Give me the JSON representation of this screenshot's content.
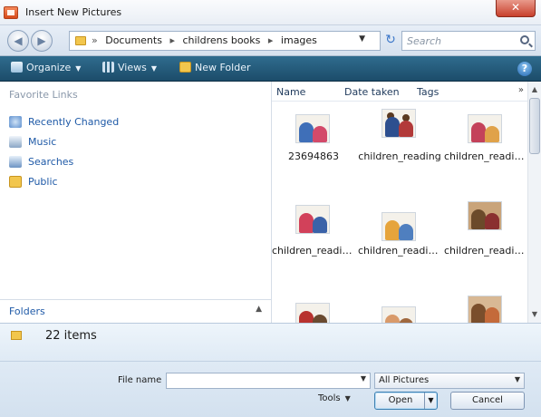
{
  "window": {
    "title": "Insert New Pictures",
    "close_glyph": "✕"
  },
  "address": {
    "crumbs": [
      "Documents",
      "childrens books",
      "images"
    ],
    "separator": "▸",
    "prefix": "»",
    "search_placeholder": "Search"
  },
  "toolbar": {
    "organize": "Organize",
    "views": "Views",
    "new_folder": "New Folder",
    "help_glyph": "?"
  },
  "nav": {
    "favorites_header": "Favorite Links",
    "items": [
      {
        "label": "Recently Changed",
        "icon": "recently-changed-icon"
      },
      {
        "label": "Music",
        "icon": "music-icon"
      },
      {
        "label": "Searches",
        "icon": "searches-icon"
      },
      {
        "label": "Public",
        "icon": "public-folder-icon"
      }
    ],
    "folders_label": "Folders"
  },
  "columns": {
    "name": "Name",
    "date_taken": "Date taken",
    "tags": "Tags",
    "more": "»"
  },
  "files": [
    {
      "name": "23694863"
    },
    {
      "name": "children_reading"
    },
    {
      "name": "children_readin..."
    },
    {
      "name": "children_readin..."
    },
    {
      "name": "children_readin..."
    },
    {
      "name": "children_readin..."
    },
    {
      "name": ""
    },
    {
      "name": ""
    },
    {
      "name": ""
    }
  ],
  "status": {
    "item_count": "22 items"
  },
  "form": {
    "file_name_label": "File name",
    "file_name_value": "",
    "filter_value": "All Pictures",
    "tools_label": "Tools",
    "open_label": "Open",
    "cancel_label": "Cancel"
  }
}
